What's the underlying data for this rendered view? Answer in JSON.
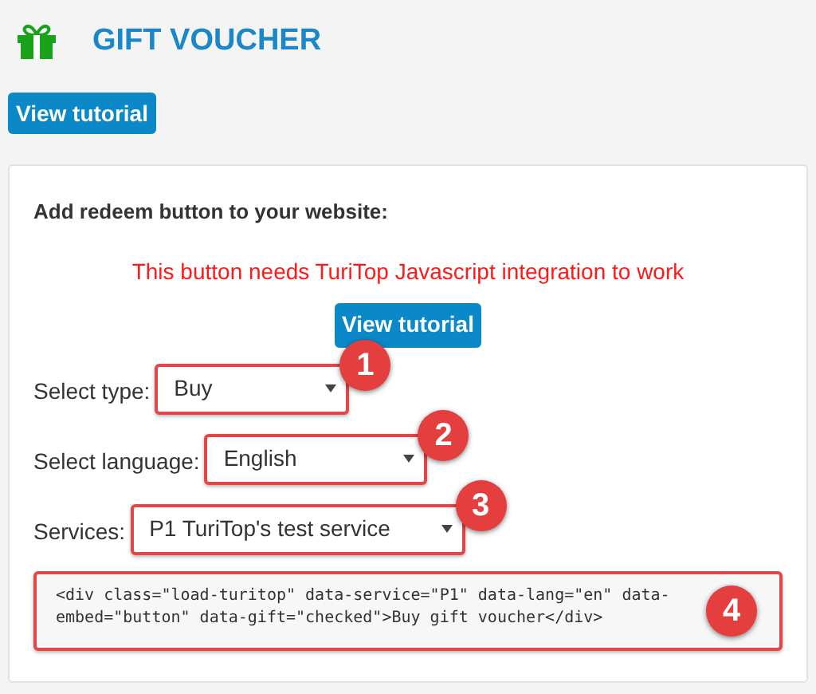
{
  "header": {
    "title": "GIFT VOUCHER"
  },
  "tutorial_button": "View tutorial",
  "card": {
    "heading": "Add redeem button to your website:",
    "warning": "This button needs TuriTop Javascript integration to work",
    "tutorial_button": "View tutorial",
    "selects": [
      {
        "label": "Select type:",
        "value": "Buy",
        "badge": "1"
      },
      {
        "label": "Select language:",
        "value": "English",
        "badge": "2"
      },
      {
        "label": "Services:",
        "value": "P1 TuriTop's test service",
        "badge": "3"
      }
    ],
    "code": {
      "text": "<div class=\"load-turitop\" data-service=\"P1\" data-lang=\"en\" data-embed=\"button\" data-gift=\"checked\">Buy gift voucher</div>",
      "badge": "4"
    }
  }
}
